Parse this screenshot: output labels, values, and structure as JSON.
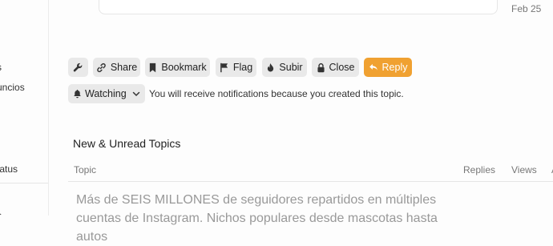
{
  "sidebar": {
    "items": [
      {
        "label": "s"
      },
      {
        "label": "uncios"
      },
      {
        "label": "tatus"
      },
      {
        "label": "s"
      }
    ]
  },
  "post": {
    "date": "Feb 25"
  },
  "actions": {
    "share": "Share",
    "bookmark": "Bookmark",
    "flag": "Flag",
    "subir": "Subir",
    "close": "Close",
    "reply": "Reply"
  },
  "notifications": {
    "level": "Watching",
    "message": "You will receive notifications because you created this topic."
  },
  "topics": {
    "heading": "New & Unread Topics",
    "columns": {
      "topic": "Topic",
      "replies": "Replies",
      "views": "Views",
      "activity": "A"
    },
    "rows": [
      {
        "title": "Más de SEIS MILLONES de seguidores repartidos en múltiples cuentas de Instagram. Nichos populares desde mascotas hasta autos"
      }
    ]
  },
  "colors": {
    "accent": "#f0a131",
    "button_bg": "#e9e9e9"
  }
}
